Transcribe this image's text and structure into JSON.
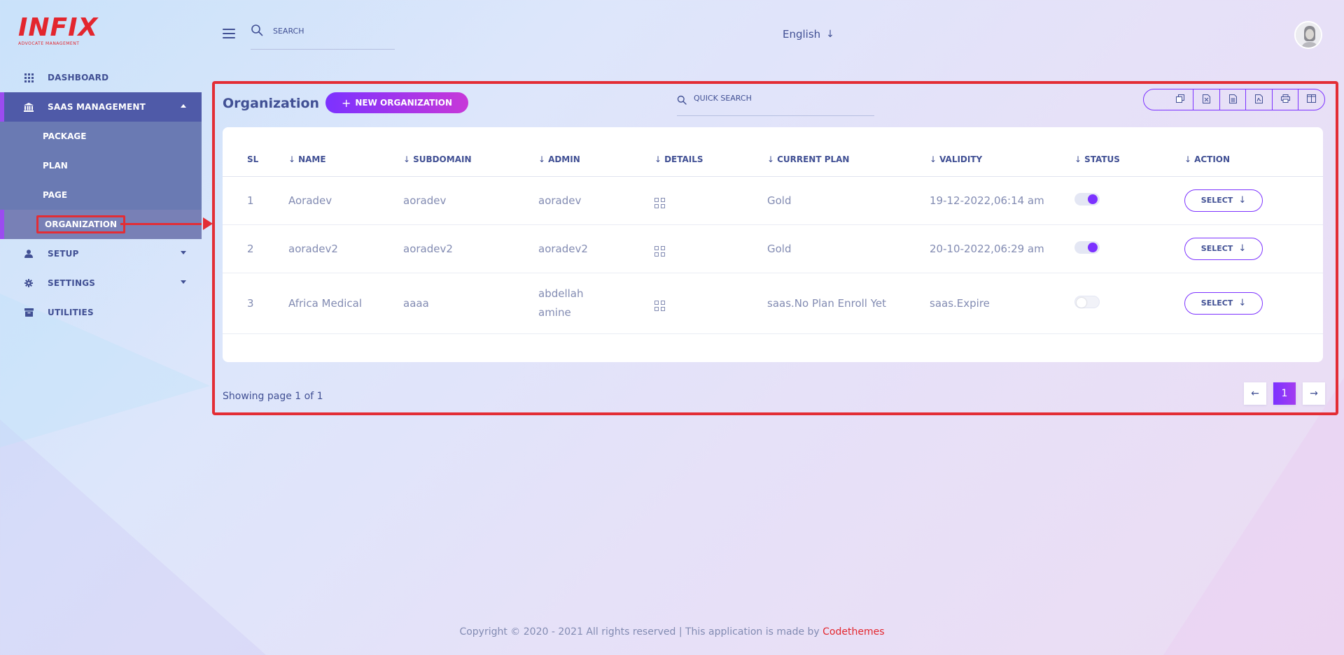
{
  "brand": {
    "logo_text": "INFIX",
    "logo_sub": "ADVOCATE MANAGEMENT",
    "color": "#e3262e"
  },
  "sidebar": {
    "items": [
      {
        "label": "Dashboard",
        "icon": "grid-icon"
      },
      {
        "label": "SaaS Management",
        "icon": "bank-icon",
        "active": true
      },
      {
        "label": "Setup",
        "icon": "user-icon"
      },
      {
        "label": "Settings",
        "icon": "gear-icon"
      },
      {
        "label": "Utilities",
        "icon": "archive-icon"
      }
    ],
    "sub_items": [
      "Package",
      "Plan",
      "Page",
      "Organization"
    ]
  },
  "header": {
    "search_placeholder": "SEARCH",
    "language": "English",
    "language_arrow": "↓"
  },
  "main": {
    "title": "Organization",
    "new_button": "NEW ORGANIZATION",
    "quick_search_placeholder": "QUICK SEARCH",
    "export_icons": [
      "copy-icon",
      "excel-icon",
      "csv-icon",
      "pdf-icon",
      "print-icon",
      "columns-icon"
    ],
    "table": {
      "headers": [
        "SL",
        "NAME",
        "SUBDOMAIN",
        "ADMIN",
        "DETAILS",
        "CURRENT PLAN",
        "VALIDITY",
        "STATUS",
        "ACTION"
      ],
      "rows": [
        {
          "sl": "1",
          "name": "Aoradev",
          "subdomain": "aoradev",
          "admin": "aoradev",
          "plan": "Gold",
          "validity": "19-12-2022,06:14 am",
          "status": "on",
          "action": "SELECT"
        },
        {
          "sl": "2",
          "name": "aoradev2",
          "subdomain": "aoradev2",
          "admin": "aoradev2",
          "plan": "Gold",
          "validity": "20-10-2022,06:29 am",
          "status": "on",
          "action": "SELECT"
        },
        {
          "sl": "3",
          "name": "Africa Medical",
          "subdomain": "aaaa",
          "admin_line1": "abdellah",
          "admin_line2": "amine",
          "plan": "saas.No Plan Enroll Yet",
          "validity": "saas.Expire",
          "status": "off",
          "action": "SELECT"
        }
      ]
    },
    "showing": "Showing page 1 of 1",
    "pagination": {
      "prev": "←",
      "current": "1",
      "next": "→"
    }
  },
  "footer": {
    "text": "Copyright © 2020 - 2021 All rights reserved | This application is made by ",
    "brand": "Codethemes"
  },
  "colors": {
    "accent": "#7c32ff",
    "accent2": "#c738d8",
    "text": "#415094",
    "muted": "#828bb2",
    "annotation": "#e32d35"
  }
}
